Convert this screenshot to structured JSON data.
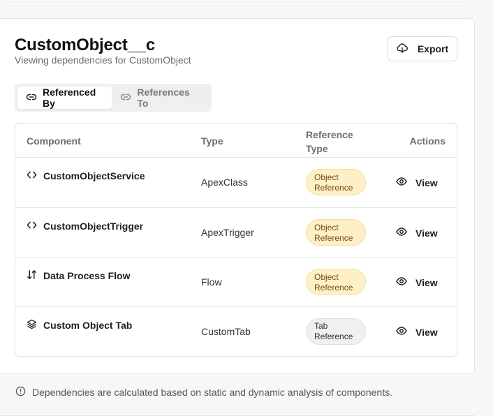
{
  "header": {
    "title": "CustomObject__c",
    "subtitle": "Viewing dependencies for CustomObject",
    "export_label": "Export"
  },
  "tabs": [
    {
      "label": "Referenced By",
      "icon": "link-icon",
      "active": true
    },
    {
      "label": "References To",
      "icon": "link-icon",
      "active": false
    }
  ],
  "table": {
    "columns": {
      "component": "Component",
      "type": "Type",
      "reference_type": "Reference Type",
      "actions": "Actions"
    },
    "rows": [
      {
        "component": "CustomObjectService",
        "icon": "code-icon",
        "type": "ApexClass",
        "reference_type": "Object Reference",
        "action": "View"
      },
      {
        "component": "CustomObjectTrigger",
        "icon": "code-icon",
        "type": "ApexTrigger",
        "reference_type": "Object Reference",
        "action": "View"
      },
      {
        "component": "Data Process Flow",
        "icon": "flow-arrows-icon",
        "type": "Flow",
        "reference_type": "Object Reference",
        "action": "View"
      },
      {
        "component": "Custom Object Tab",
        "icon": "layers-icon",
        "type": "CustomTab",
        "reference_type": "Tab Reference",
        "action": "View"
      }
    ]
  },
  "footer": {
    "note": "Dependencies are calculated based on static and dynamic analysis of components."
  },
  "colors": {
    "object_badge_bg": "#fdf0c7",
    "object_badge_text": "#7a4a10",
    "tab_badge_bg": "#f0f0f1"
  }
}
